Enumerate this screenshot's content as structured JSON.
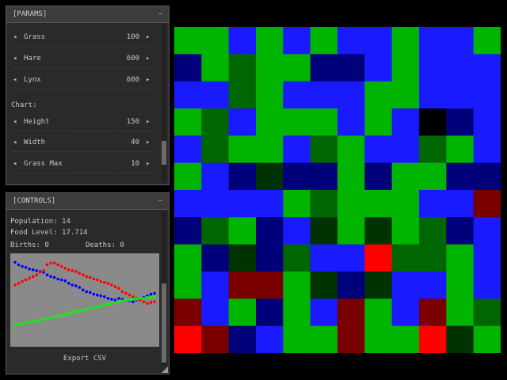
{
  "params_panel": {
    "title": "[PARAMS]",
    "collapse_symbol": "−",
    "rows_top": [
      {
        "label": "Grass",
        "value": "100"
      },
      {
        "label": "Hare",
        "value": "600"
      },
      {
        "label": "Lynx",
        "value": "600"
      }
    ],
    "chart_section_label": "Chart:",
    "rows_chart": [
      {
        "label": "Height",
        "value": "150"
      },
      {
        "label": "Width",
        "value": "40"
      },
      {
        "label": "Grass Max",
        "value": "10"
      }
    ],
    "left_arrow": "◂",
    "right_arrow": "▸"
  },
  "controls_panel": {
    "title": "[CONTROLS]",
    "collapse_symbol": "−",
    "population": "Population: 14",
    "food_level": "Food Level: 17.714",
    "births": "Births: 0",
    "deaths": "Deaths: 0",
    "export_label": "Export CSV"
  },
  "colors": {
    "green": "#00b400",
    "dark_green": "#006600",
    "blue": "#1a1aff",
    "navy": "#00007a",
    "red": "#ff0000",
    "dark_red": "#7a0000",
    "black": "#000000"
  },
  "grid": {
    "rows": 12,
    "cols": 12,
    "cells": [
      [
        "G",
        "G",
        "B",
        "G",
        "B",
        "G",
        "B",
        "B",
        "G",
        "B",
        "B",
        "G"
      ],
      [
        "N",
        "G",
        "g",
        "G",
        "G",
        "N",
        "N",
        "B",
        "G",
        "B",
        "B",
        "B"
      ],
      [
        "B",
        "B",
        "g",
        "G",
        "B",
        "B",
        "B",
        "G",
        "G",
        "B",
        "B",
        "B"
      ],
      [
        "G",
        "g",
        "B",
        "G",
        "G",
        "G",
        "B",
        "G",
        "B",
        "K",
        "N",
        "B"
      ],
      [
        "B",
        "g",
        "G",
        "G",
        "B",
        "g",
        "G",
        "B",
        "B",
        "g",
        "G",
        "B"
      ],
      [
        "G",
        "B",
        "N",
        "k",
        "N",
        "N",
        "G",
        "N",
        "G",
        "G",
        "N",
        "N"
      ],
      [
        "B",
        "B",
        "B",
        "B",
        "G",
        "g",
        "G",
        "G",
        "G",
        "B",
        "B",
        "R"
      ],
      [
        "N",
        "g",
        "G",
        "N",
        "B",
        "k",
        "G",
        "k",
        "G",
        "g",
        "N",
        "B"
      ],
      [
        "G",
        "N",
        "k",
        "N",
        "g",
        "B",
        "B",
        "X",
        "g",
        "g",
        "G",
        "B"
      ],
      [
        "G",
        "B",
        "R",
        "R",
        "G",
        "k",
        "N",
        "k",
        "B",
        "B",
        "G",
        "B"
      ],
      [
        "R",
        "B",
        "G",
        "N",
        "G",
        "B",
        "R",
        "G",
        "B",
        "R",
        "G",
        "g"
      ],
      [
        "X",
        "R",
        "N",
        "B",
        "G",
        "G",
        "R",
        "G",
        "G",
        "X",
        "k",
        "G"
      ]
    ]
  },
  "chart_data": {
    "type": "line",
    "x": [
      0,
      1,
      2,
      3,
      4,
      5,
      6,
      7,
      8,
      9,
      10,
      11,
      12,
      13,
      14,
      15,
      16,
      17,
      18,
      19,
      20,
      21,
      22,
      23,
      24,
      25,
      26,
      27,
      28,
      29,
      30,
      31,
      32,
      33,
      34,
      35,
      36,
      37,
      38,
      39
    ],
    "series": [
      {
        "color": "#0000ff",
        "values": [
          95,
          92,
          90,
          89,
          87,
          86,
          85,
          84,
          83,
          80,
          78,
          77,
          75,
          74,
          73,
          70,
          68,
          67,
          65,
          62,
          60,
          59,
          57,
          56,
          55,
          54,
          52,
          51,
          50,
          52,
          51,
          50,
          49,
          48,
          50,
          51,
          53,
          55,
          57,
          58
        ]
      },
      {
        "color": "#ff0000",
        "values": [
          68,
          70,
          72,
          74,
          76,
          78,
          80,
          83,
          85,
          92,
          94,
          94,
          92,
          90,
          88,
          86,
          85,
          84,
          82,
          80,
          78,
          77,
          75,
          74,
          72,
          71,
          70,
          68,
          66,
          64,
          60,
          58,
          56,
          54,
          52,
          50,
          48,
          46,
          47,
          48
        ]
      },
      {
        "color": "#00ff00",
        "values": [
          20,
          21,
          22,
          23,
          24,
          24,
          25,
          26,
          27,
          28,
          29,
          30,
          31,
          32,
          33,
          34,
          35,
          36,
          37,
          38,
          39,
          40,
          41,
          42,
          43,
          44,
          45,
          46,
          47,
          48,
          49,
          50,
          50,
          51,
          51,
          52,
          52,
          53,
          53,
          54
        ]
      }
    ]
  }
}
